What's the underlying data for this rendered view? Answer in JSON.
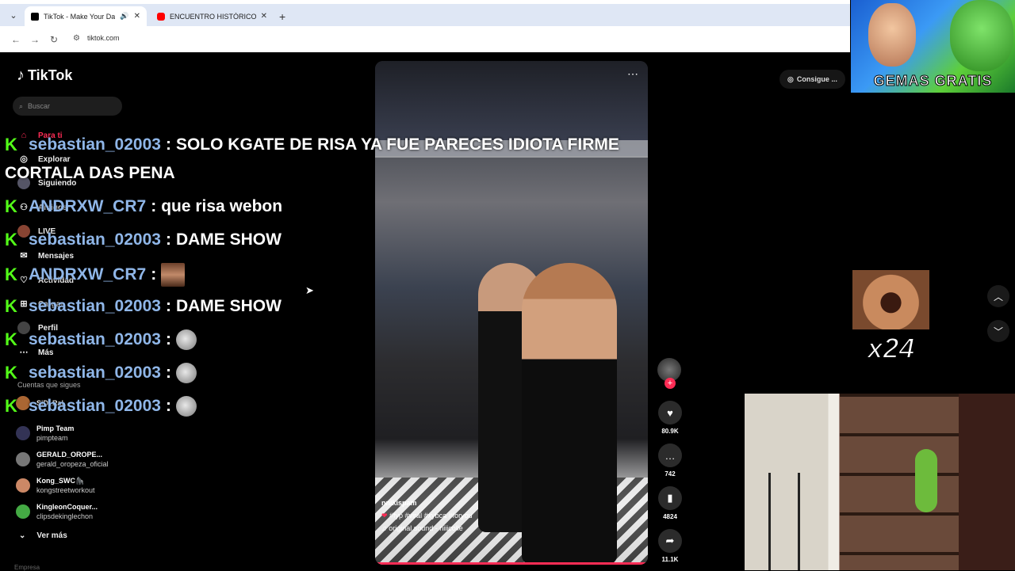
{
  "browser": {
    "tabs": [
      {
        "title": "TikTok - Make Your Day"
      },
      {
        "title": "ENCUENTRO HISTÓRICO QUE..."
      }
    ],
    "address": "tiktok.com"
  },
  "sidebar": {
    "logo": "TikTok",
    "search_placeholder": "Buscar",
    "nav": [
      {
        "label": "Para ti",
        "icon": "home-icon"
      },
      {
        "label": "Explorar",
        "icon": "compass-icon"
      },
      {
        "label": "Siguiendo",
        "icon": "following-icon"
      },
      {
        "label": "Amigos",
        "icon": "friends-icon"
      },
      {
        "label": "LIVE",
        "icon": "live-icon"
      },
      {
        "label": "Mensajes",
        "icon": "messages-icon"
      },
      {
        "label": "Actividad",
        "icon": "activity-icon"
      },
      {
        "label": "Cargar",
        "icon": "upload-icon"
      },
      {
        "label": "Perfil",
        "icon": "profile-icon"
      },
      {
        "label": "Más",
        "icon": "more-icon"
      }
    ],
    "following_label": "Cuentas que sigues",
    "accounts": [
      {
        "name": "SiD_RaL",
        "handle": ""
      },
      {
        "name": "Pimp Team",
        "handle": "pimpteam"
      },
      {
        "name": "GERALD_OROPE...",
        "handle": "gerald_oropeza_oficial"
      },
      {
        "name": "Kong_SWC🦍",
        "handle": "kongstreetworkout"
      },
      {
        "name": "KingleonCoquer...",
        "handle": "clipsdekinglechon"
      }
    ],
    "see_more": "Ver más",
    "bottom_label": "Empresa"
  },
  "chat": {
    "lines": [
      {
        "user": "sebastian_02003",
        "msg": "SOLO KGATE DE RISA YA FUE PARECES IDIOTA FIRME"
      },
      {
        "user": "ANDRXW_CR7",
        "msg": "que risa webon"
      },
      {
        "user": "sebastian_02003",
        "msg": "DAME SHOW"
      },
      {
        "user": "ANDRXW_CR7",
        "msg": ""
      },
      {
        "user": "sebastian_02003",
        "msg": "DAME SHOW"
      },
      {
        "user": "sebastian_02003",
        "msg": ""
      },
      {
        "user": "sebastian_02003",
        "msg": ""
      },
      {
        "user": "sebastian_02003",
        "msg": ""
      }
    ],
    "continuation": "CORTALA DAS PENA",
    "separator": ":"
  },
  "video": {
    "author": "nnikispam",
    "hashtags": "#fyp #viral #xybca #foryou",
    "sound": "♫ original sound - niiicolle",
    "likes": "80.9K",
    "comments": "742",
    "saves": "4824",
    "shares": "11.1K"
  },
  "get_coins": "Consigue ...",
  "ad_banner": {
    "text": "GEMAS GRATIS"
  },
  "meme_counter": "x24",
  "colors": {
    "accent": "#fe2c55",
    "kick_green": "#53fc18",
    "username_blue": "#8fb6e8"
  }
}
